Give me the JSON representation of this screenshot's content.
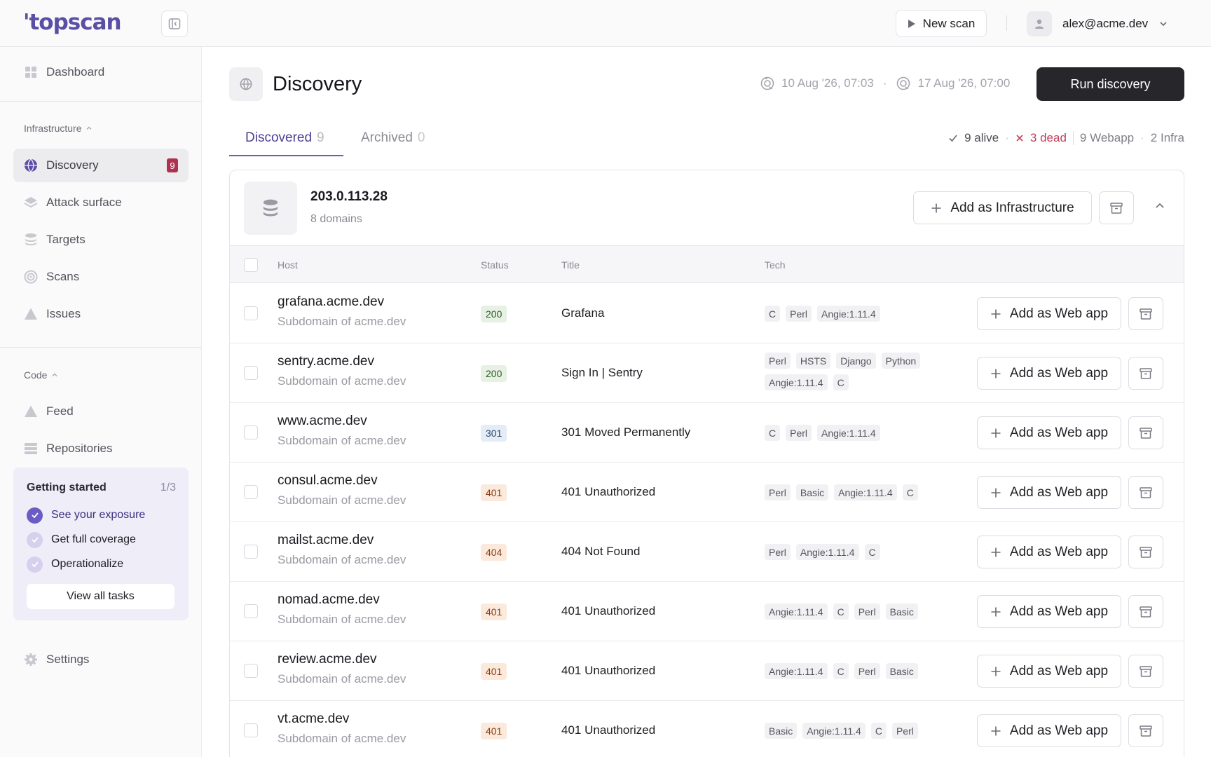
{
  "app": {
    "logo": "'topscan"
  },
  "topbar": {
    "new_scan_label": "New scan",
    "user_email": "alex@acme.dev"
  },
  "sidebar": {
    "dashboard": "Dashboard",
    "infra_section": "Infrastructure",
    "infra_items": [
      {
        "label": "Discovery",
        "badge": "9"
      },
      {
        "label": "Attack surface"
      },
      {
        "label": "Targets"
      },
      {
        "label": "Scans"
      },
      {
        "label": "Issues"
      }
    ],
    "code_section": "Code",
    "code_items": [
      {
        "label": "Feed"
      },
      {
        "label": "Repositories"
      }
    ],
    "settings": "Settings",
    "getting_started": {
      "title": "Getting started",
      "progress": "1/3",
      "tasks": [
        {
          "label": "See your exposure",
          "done": true
        },
        {
          "label": "Get full coverage",
          "done": false
        },
        {
          "label": "Operationalize",
          "done": false
        }
      ],
      "view_all_label": "View all tasks"
    }
  },
  "page": {
    "title": "Discovery",
    "last_run": "10 Aug '26, 07:03",
    "next_run": "17 Aug '26, 07:00",
    "run_button": "Run discovery",
    "tabs": [
      {
        "label": "Discovered",
        "count": "9"
      },
      {
        "label": "Archived",
        "count": "0"
      }
    ],
    "summary": {
      "alive": "9 alive",
      "dead": "3 dead",
      "webapp": "9 Webapp",
      "infra": "2 Infra"
    }
  },
  "group": {
    "ip": "203.0.113.28",
    "subtitle": "8 domains",
    "add_infra_label": "Add as Infrastructure",
    "columns": {
      "host": "Host",
      "status": "Status",
      "title": "Title",
      "tech": "Tech"
    },
    "add_web_label": "Add as Web app",
    "rows": [
      {
        "host": "grafana.acme.dev",
        "sub": "Subdomain of acme.dev",
        "status": "200",
        "title": "Grafana",
        "tech": [
          "C",
          "Perl",
          "Angie:1.11.4"
        ]
      },
      {
        "host": "sentry.acme.dev",
        "sub": "Subdomain of acme.dev",
        "status": "200",
        "title": "Sign In | Sentry",
        "tech": [
          "Perl",
          "HSTS",
          "Django",
          "Python",
          "Angie:1.11.4",
          "C"
        ]
      },
      {
        "host": "www.acme.dev",
        "sub": "Subdomain of acme.dev",
        "status": "301",
        "title": "301 Moved Permanently",
        "tech": [
          "C",
          "Perl",
          "Angie:1.11.4"
        ]
      },
      {
        "host": "consul.acme.dev",
        "sub": "Subdomain of acme.dev",
        "status": "401",
        "title": "401 Unauthorized",
        "tech": [
          "Perl",
          "Basic",
          "Angie:1.11.4",
          "C"
        ]
      },
      {
        "host": "mailst.acme.dev",
        "sub": "Subdomain of acme.dev",
        "status": "404",
        "title": "404 Not Found",
        "tech": [
          "Perl",
          "Angie:1.11.4",
          "C"
        ]
      },
      {
        "host": "nomad.acme.dev",
        "sub": "Subdomain of acme.dev",
        "status": "401",
        "title": "401 Unauthorized",
        "tech": [
          "Angie:1.11.4",
          "C",
          "Perl",
          "Basic"
        ]
      },
      {
        "host": "review.acme.dev",
        "sub": "Subdomain of acme.dev",
        "status": "401",
        "title": "401 Unauthorized",
        "tech": [
          "Angie:1.11.4",
          "C",
          "Perl",
          "Basic"
        ]
      },
      {
        "host": "vt.acme.dev",
        "sub": "Subdomain of acme.dev",
        "status": "401",
        "title": "401 Unauthorized",
        "tech": [
          "Basic",
          "Angie:1.11.4",
          "C",
          "Perl"
        ]
      }
    ]
  },
  "colors": {
    "accent": "#6b5bc4",
    "badge": "#b0314f",
    "dead": "#c0405a"
  }
}
